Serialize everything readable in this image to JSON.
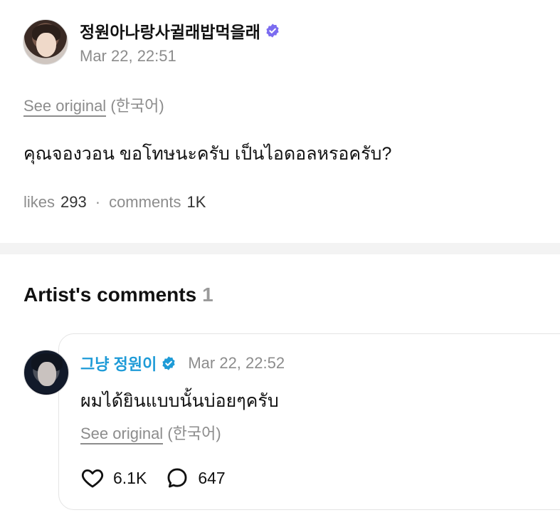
{
  "post": {
    "author": "정원아나랑사귈래밥먹을래",
    "timestamp": "Mar 22, 22:51",
    "see_original": "See original",
    "original_language": "(한국어)",
    "text": "คุณจองวอน ขอโทษนะครับ เป็นไอดอลหรอครับ?",
    "likes_label": "likes",
    "likes_count": "293",
    "separator": "·",
    "comments_label": "comments",
    "comments_count": "1K"
  },
  "artist_comments": {
    "title": "Artist's comments",
    "count": "1",
    "comment": {
      "author": "그냥 정원이",
      "timestamp": "Mar 22, 22:52",
      "text": "ผมได้ยินแบบนั้นบ่อยๆครับ",
      "see_original": "See original",
      "original_language": "(한국어)",
      "likes_count": "6.1K",
      "replies_count": "647"
    }
  },
  "colors": {
    "artist_name": "#1e9bd7",
    "muted_text": "#8c8c8c",
    "verified_purple": "#7b6cf0",
    "verified_blue": "#1e9bd7"
  },
  "icons": {
    "post_author_badge": "verified-badge-icon",
    "artist_badge": "verified-check-icon",
    "like": "heart-icon",
    "reply": "chat-bubble-icon"
  }
}
